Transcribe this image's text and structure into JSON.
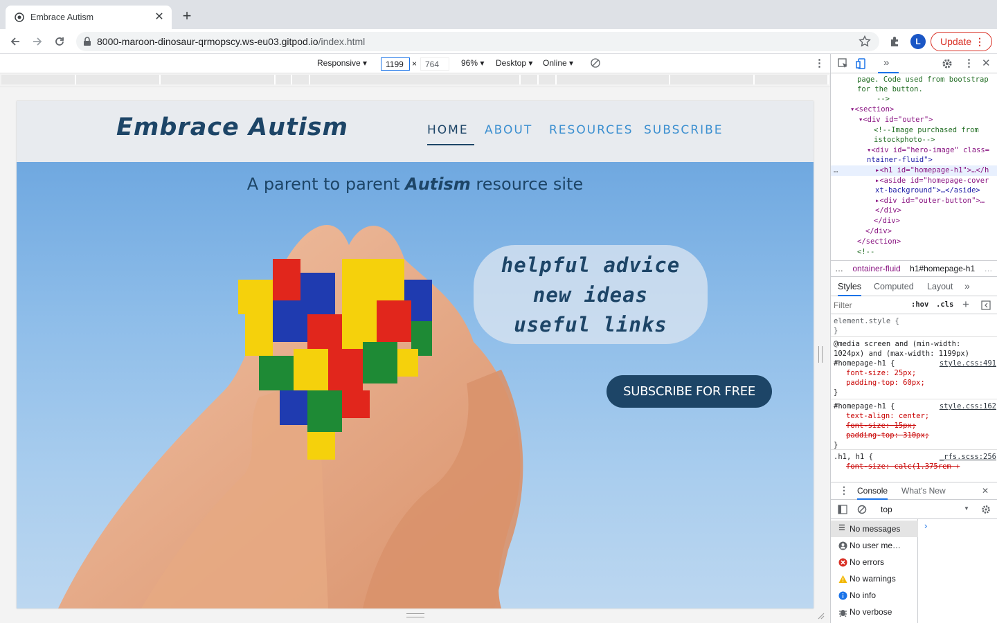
{
  "browser": {
    "tab_title": "Embrace Autism",
    "url_host": "8000-maroon-dinosaur-qrmopscy.ws-eu03.gitpod.io",
    "url_path": "/index.html",
    "profile_initial": "L",
    "update_label": "Update"
  },
  "device_toolbar": {
    "device": "Responsive",
    "width": "1199",
    "height": "764",
    "zoom": "96%",
    "mode": "Desktop",
    "network": "Online"
  },
  "site": {
    "logo": "Embrace Autism",
    "nav": [
      "HOME",
      "ABOUT",
      "RESOURCES",
      "SUBSCRIBE"
    ],
    "h1_before": "A parent to parent ",
    "h1_em": "Autism",
    "h1_after": " resource site",
    "bubble": [
      "helpful advice",
      "new ideas",
      "useful links"
    ],
    "cta": "SUBSCRIBE FOR FREE"
  },
  "devtools": {
    "elements": [
      "page. Code used from bootstrap",
      "for the button.",
      "-->",
      "<section>",
      "<div id=\"outer\">",
      "<!--Image purchased from",
      "istockphoto-->",
      "<div id=\"hero-image\" class=",
      "ntainer-fluid\">",
      "<h1 id=\"homepage-h1\">…</h",
      "<aside id=\"homepage-cover",
      "xt-background\">…</aside>",
      "<div id=\"outer-button\">…",
      "</div>",
      "</div>",
      "</div>",
      "</section>",
      "<!--"
    ],
    "breadcrumbs": [
      "…",
      "ontainer-fluid",
      "h1#homepage-h1",
      "…"
    ],
    "style_tabs": [
      "Styles",
      "Computed",
      "Layout"
    ],
    "filter_placeholder": "Filter",
    "hov": ":hov",
    "cls": ".cls",
    "rules": {
      "element_style": "element.style {",
      "media": "@media screen and (min-width: 1024px) and (max-width: 1199px)",
      "selector": "#homepage-h1 {",
      "src1": "style.css:491",
      "p1": "font-size: 25px;",
      "p2": "padding-top: 60px;",
      "src2": "style.css:162",
      "p3": "text-align: center;",
      "p4": "font-size: 15px;",
      "p5": "padding-top: 310px;",
      "selector3": ".h1, h1 {",
      "src3": "_rfs.scss:256",
      "p6": "font-size: calc(1.375rem +",
      "close": "}"
    },
    "console_tabs": [
      "Console",
      "What's New"
    ],
    "context": "top",
    "messages": [
      "No messages",
      "No user me…",
      "No errors",
      "No warnings",
      "No info",
      "No verbose"
    ]
  },
  "colors": {
    "brand_dark": "#1d4567",
    "nav_link": "#3b8fd0",
    "update_red": "#d93025"
  }
}
